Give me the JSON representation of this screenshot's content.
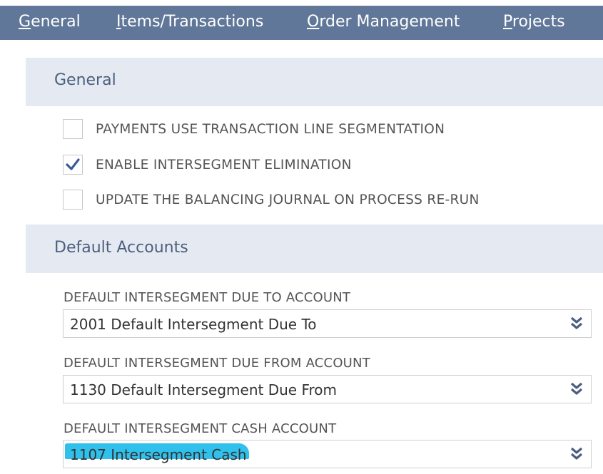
{
  "tabs": [
    {
      "mnemonic": "G",
      "rest": "eneral"
    },
    {
      "mnemonic": "I",
      "rest": "tems/Transactions"
    },
    {
      "mnemonic": "O",
      "rest": "rder Management"
    },
    {
      "mnemonic": "P",
      "rest": "rojects"
    }
  ],
  "general_section": {
    "title": "General",
    "checkboxes": [
      {
        "label": "PAYMENTS USE TRANSACTION LINE SEGMENTATION",
        "checked": false
      },
      {
        "label": "ENABLE INTERSEGMENT ELIMINATION",
        "checked": true
      },
      {
        "label": "UPDATE THE BALANCING JOURNAL ON PROCESS RE-RUN",
        "checked": false
      }
    ]
  },
  "default_accounts_section": {
    "title": "Default Accounts",
    "fields": [
      {
        "label": "DEFAULT INTERSEGMENT DUE TO ACCOUNT",
        "value": "2001 Default Intersegment Due To"
      },
      {
        "label": "DEFAULT INTERSEGMENT DUE FROM ACCOUNT",
        "value": "1130 Default Intersegment Due From"
      },
      {
        "label": "DEFAULT INTERSEGMENT CASH ACCOUNT",
        "value": "1107 Intersegment Cash"
      }
    ]
  },
  "colors": {
    "tab_bar": "#607799",
    "section_header_bg": "#e5eaf2",
    "section_title": "#4c5f7e",
    "checkmark": "#3b5b96",
    "highlight": "#2fc0ec"
  }
}
